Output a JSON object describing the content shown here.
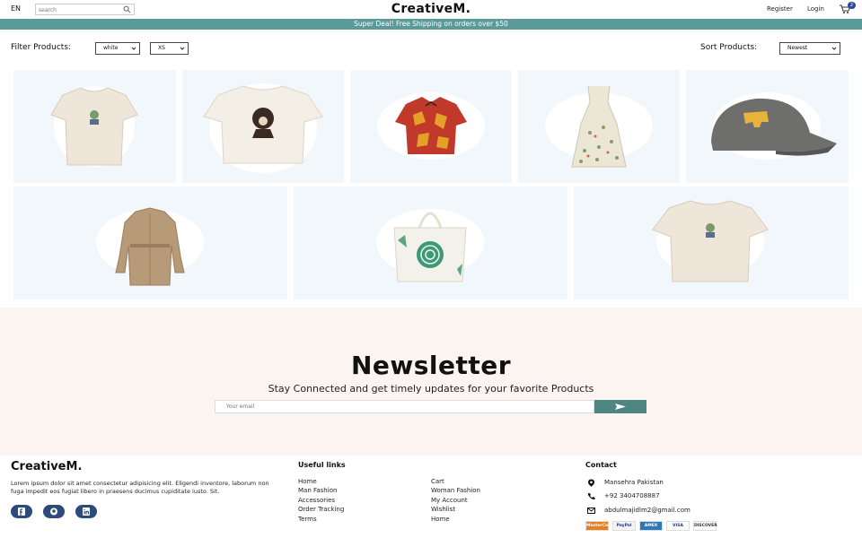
{
  "header": {
    "lang": "EN",
    "search_placeholder": "search",
    "logo": "CreativeM.",
    "register": "Register",
    "login": "Login",
    "cart_count": "2"
  },
  "promo": "Super Deal! Free Shipping on orders over $50",
  "filters": {
    "label": "Filter Products:",
    "color": "white",
    "size": "XS",
    "sort_label": "Sort Products:",
    "sort": "Newest"
  },
  "products": [
    {
      "icon": "tshirt-icon",
      "color": "#efe6da"
    },
    {
      "icon": "tshirt-icon",
      "color": "#f3efe6"
    },
    {
      "icon": "shirt-icon",
      "color": "#c0392b"
    },
    {
      "icon": "dress-icon",
      "color": "#ece6d4"
    },
    {
      "icon": "cap-icon",
      "color": "#6e6f6c"
    },
    {
      "icon": "coat-icon",
      "color": "#b79a78"
    },
    {
      "icon": "tote-bag-icon",
      "color": "#f4f1ea"
    },
    {
      "icon": "tshirt-icon",
      "color": "#efe6da"
    }
  ],
  "newsletter": {
    "title": "Newsletter",
    "subtitle": "Stay Connected and get timely updates for your favorite Products",
    "placeholder": "Your email"
  },
  "footer": {
    "logo": "CreativeM.",
    "description": "Lorem ipsum dolor sit amet consectetur adipisicing elit. Eligendi inventore, laborum non fuga impedit eos fugiat libero in praesens ducimus cupiditate iusto. Sit.",
    "useful_title": "Useful links",
    "links_col1": [
      "Home",
      "Man Fashion",
      "Accessories",
      "Order Tracking",
      "Terms"
    ],
    "links_col2": [
      "Cart",
      "Woman Fashion",
      "My Account",
      "Wishlist",
      "Home"
    ],
    "contact_title": "Contact",
    "address": "Mansehra Pakistan",
    "phone": "+92 3404708887",
    "email": "abdulmajidlm2@gmail.com",
    "payments": [
      "MasterCard",
      "PayPal",
      "AMEX",
      "VISA",
      "DISCOVER"
    ]
  }
}
